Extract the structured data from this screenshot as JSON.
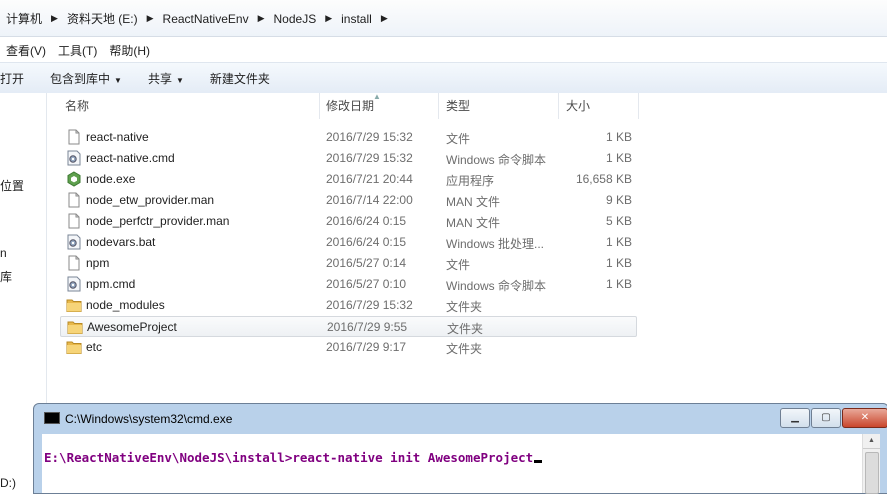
{
  "breadcrumb": [
    "计算机",
    "资料天地 (E:)",
    "ReactNativeEnv",
    "NodeJS",
    "install"
  ],
  "menu": [
    "查看(V)",
    "工具(T)",
    "帮助(H)"
  ],
  "toolbar": {
    "open": "打开",
    "include_library": "包含到库中",
    "share": "共享",
    "new_folder": "新建文件夹"
  },
  "nav": {
    "item1": "位置",
    "item2": "n",
    "item3": "库",
    "item4": "D:)"
  },
  "columns": {
    "name": "名称",
    "date": "修改日期",
    "type": "类型",
    "size": "大小"
  },
  "files": [
    {
      "name": "react-native",
      "date": "2016/7/29 15:32",
      "type": "文件",
      "size": "1 KB",
      "icon": "file-icon"
    },
    {
      "name": "react-native.cmd",
      "date": "2016/7/29 15:32",
      "type": "Windows 命令脚本",
      "size": "1 KB",
      "icon": "script-icon"
    },
    {
      "name": "node.exe",
      "date": "2016/7/21 20:44",
      "type": "应用程序",
      "size": "16,658 KB",
      "icon": "node-icon"
    },
    {
      "name": "node_etw_provider.man",
      "date": "2016/7/14 22:00",
      "type": "MAN 文件",
      "size": "9 KB",
      "icon": "file-icon"
    },
    {
      "name": "node_perfctr_provider.man",
      "date": "2016/6/24 0:15",
      "type": "MAN 文件",
      "size": "5 KB",
      "icon": "file-icon"
    },
    {
      "name": "nodevars.bat",
      "date": "2016/6/24 0:15",
      "type": "Windows 批处理...",
      "size": "1 KB",
      "icon": "script-icon"
    },
    {
      "name": "npm",
      "date": "2016/5/27 0:14",
      "type": "文件",
      "size": "1 KB",
      "icon": "file-icon"
    },
    {
      "name": "npm.cmd",
      "date": "2016/5/27 0:10",
      "type": "Windows 命令脚本",
      "size": "1 KB",
      "icon": "script-icon"
    },
    {
      "name": "node_modules",
      "date": "2016/7/29 15:32",
      "type": "文件夹",
      "size": "",
      "icon": "folder-icon"
    },
    {
      "name": "AwesomeProject",
      "date": "2016/7/29 9:55",
      "type": "文件夹",
      "size": "",
      "icon": "folder-icon"
    },
    {
      "name": "etc",
      "date": "2016/7/29 9:17",
      "type": "文件夹",
      "size": "",
      "icon": "folder-icon"
    }
  ],
  "selected_row": "AwesomeProject",
  "cmd": {
    "title": "C:\\Windows\\system32\\cmd.exe",
    "line": "E:\\ReactNativeEnv\\NodeJS\\install>react-native init AwesomeProject"
  },
  "colors": {
    "accent_arrow": "#e23b2e",
    "prompt_text": "#800080",
    "window_frame": "#b9d1ea"
  }
}
